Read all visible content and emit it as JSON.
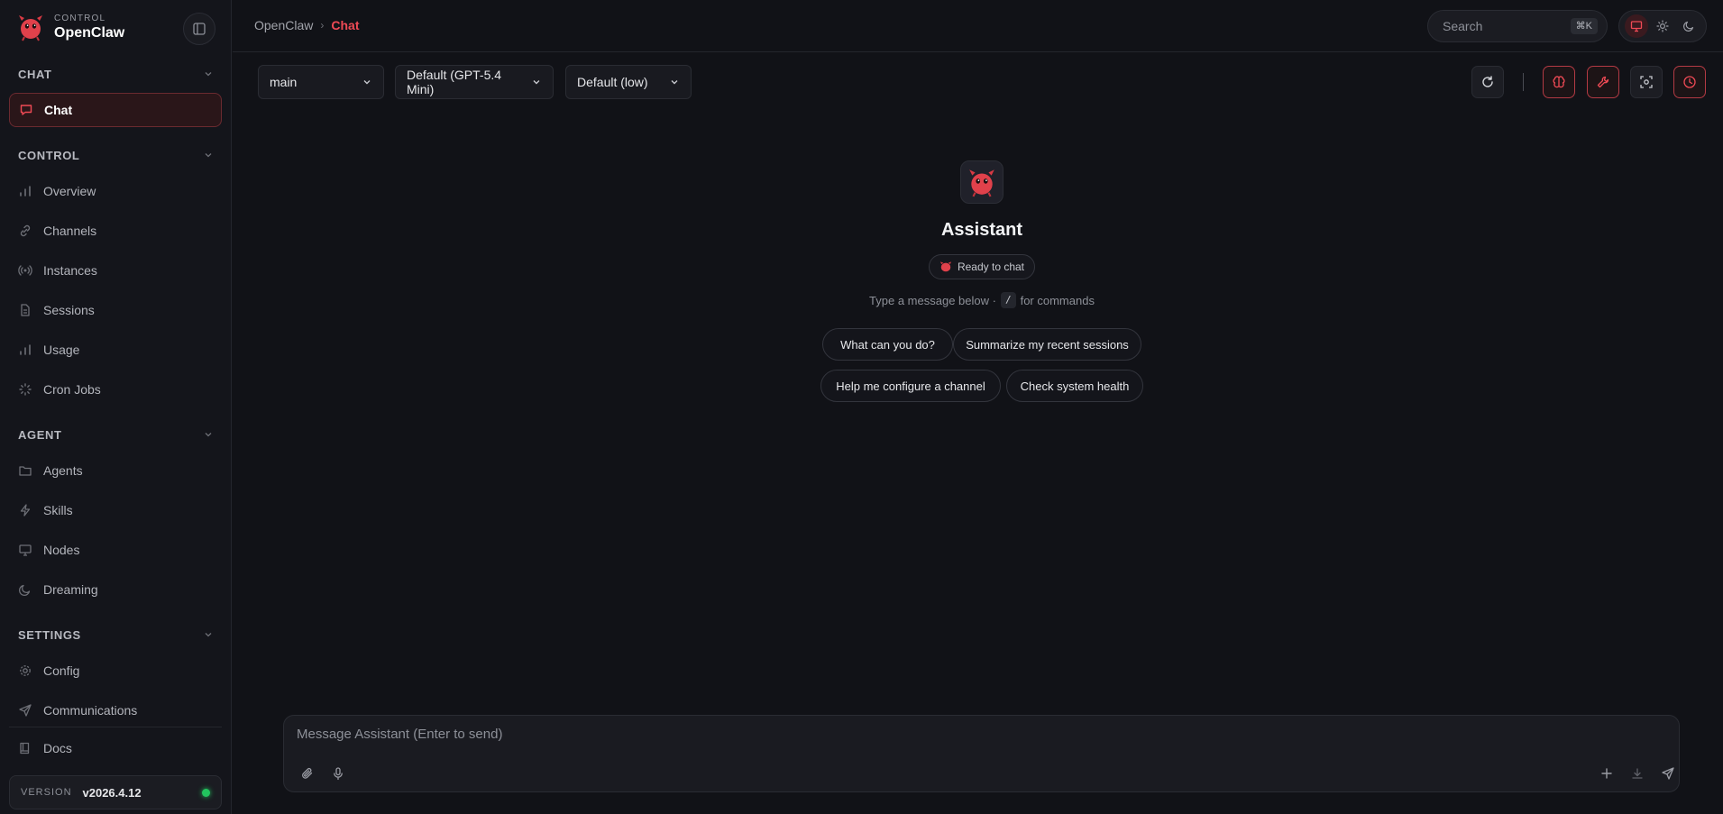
{
  "brand": {
    "small": "CONTROL",
    "name": "OpenClaw"
  },
  "sidebar": {
    "sections": {
      "chat": "CHAT",
      "control": "CONTROL",
      "agent": "AGENT",
      "settings": "SETTINGS"
    },
    "items": {
      "chat": "Chat",
      "overview": "Overview",
      "channels": "Channels",
      "instances": "Instances",
      "sessions": "Sessions",
      "usage": "Usage",
      "cron": "Cron Jobs",
      "agents": "Agents",
      "skills": "Skills",
      "nodes": "Nodes",
      "dreaming": "Dreaming",
      "config": "Config",
      "communications": "Communications",
      "docs": "Docs"
    },
    "version": {
      "label": "VERSION",
      "value": "v2026.4.12"
    }
  },
  "topbar": {
    "breadcrumb": {
      "root": "OpenClaw",
      "sep": "›",
      "current": "Chat"
    },
    "search": {
      "label": "Search",
      "shortcut": "⌘K"
    }
  },
  "toolbar": {
    "session": "main",
    "model": "Default (GPT-5.4 Mini)",
    "thinking": "Default (low)"
  },
  "welcome": {
    "title": "Assistant",
    "badge": "Ready to chat",
    "hint_before": "Type a message below ·",
    "hint_key": "/",
    "hint_after": "for commands",
    "suggestions": [
      "What can you do?",
      "Summarize my recent sessions",
      "Help me configure a channel",
      "Check system health"
    ]
  },
  "composer": {
    "placeholder": "Message Assistant (Enter to send)"
  },
  "colors": {
    "accent": "#ef4a55",
    "background": "#111217",
    "status": "#22c55e"
  }
}
